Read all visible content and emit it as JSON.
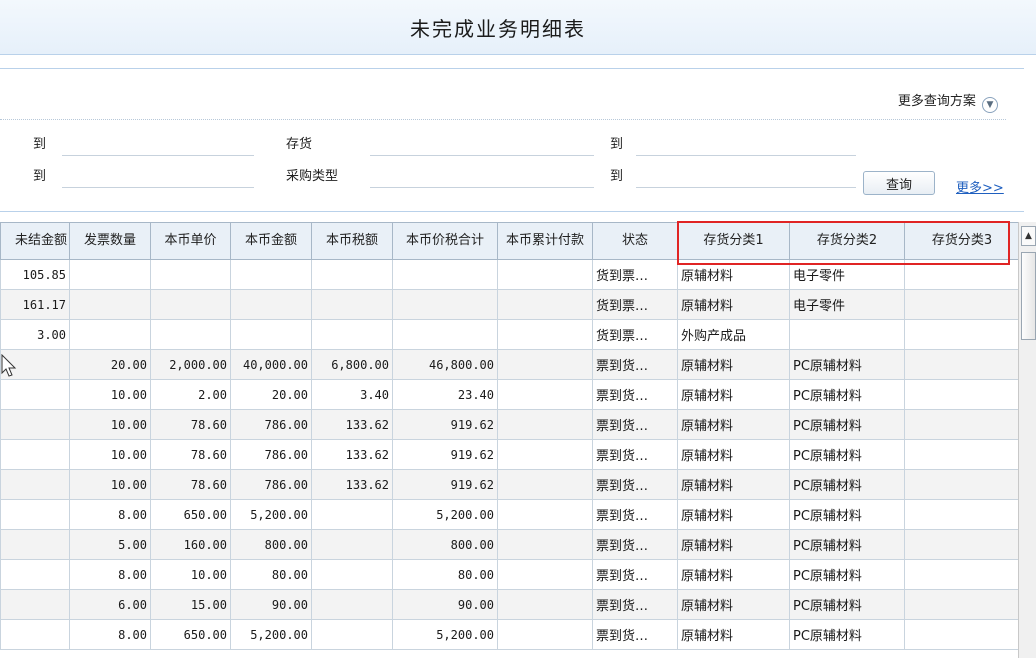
{
  "title": "未完成业务明细表",
  "query": {
    "more_schemes": "更多查询方案",
    "row1": {
      "to_label_1": "到",
      "field_label": "存货",
      "to_label_2": "到"
    },
    "row2": {
      "to_label_1": "到",
      "field_label": "采购类型",
      "to_label_2": "到"
    },
    "query_button": "查询",
    "more_link": "更多>>"
  },
  "table": {
    "headers": [
      "未结金额",
      "发票数量",
      "本币单价",
      "本币金额",
      "本币税额",
      "本币价税合计",
      "本币累计付款",
      "状态",
      "存货分类1",
      "存货分类2",
      "存货分类3"
    ],
    "rows": [
      {
        "c0": "105.85",
        "c1": "",
        "c2": "",
        "c3": "",
        "c4": "",
        "c5": "",
        "c6": "",
        "c7": "货到票…",
        "c8": "原辅材料",
        "c9": "电子零件",
        "c10": ""
      },
      {
        "c0": "161.17",
        "c1": "",
        "c2": "",
        "c3": "",
        "c4": "",
        "c5": "",
        "c6": "",
        "c7": "货到票…",
        "c8": "原辅材料",
        "c9": "电子零件",
        "c10": ""
      },
      {
        "c0": "3.00",
        "c1": "",
        "c2": "",
        "c3": "",
        "c4": "",
        "c5": "",
        "c6": "",
        "c7": "货到票…",
        "c8": "外购产成品",
        "c9": "",
        "c10": ""
      },
      {
        "c0": "",
        "c1": "20.00",
        "c2": "2,000.00",
        "c3": "40,000.00",
        "c4": "6,800.00",
        "c5": "46,800.00",
        "c6": "",
        "c7": "票到货…",
        "c8": "原辅材料",
        "c9": "PC原辅材料",
        "c10": ""
      },
      {
        "c0": "",
        "c1": "10.00",
        "c2": "2.00",
        "c3": "20.00",
        "c4": "3.40",
        "c5": "23.40",
        "c6": "",
        "c7": "票到货…",
        "c8": "原辅材料",
        "c9": "PC原辅材料",
        "c10": ""
      },
      {
        "c0": "",
        "c1": "10.00",
        "c2": "78.60",
        "c3": "786.00",
        "c4": "133.62",
        "c5": "919.62",
        "c6": "",
        "c7": "票到货…",
        "c8": "原辅材料",
        "c9": "PC原辅材料",
        "c10": ""
      },
      {
        "c0": "",
        "c1": "10.00",
        "c2": "78.60",
        "c3": "786.00",
        "c4": "133.62",
        "c5": "919.62",
        "c6": "",
        "c7": "票到货…",
        "c8": "原辅材料",
        "c9": "PC原辅材料",
        "c10": ""
      },
      {
        "c0": "",
        "c1": "10.00",
        "c2": "78.60",
        "c3": "786.00",
        "c4": "133.62",
        "c5": "919.62",
        "c6": "",
        "c7": "票到货…",
        "c8": "原辅材料",
        "c9": "PC原辅材料",
        "c10": ""
      },
      {
        "c0": "",
        "c1": "8.00",
        "c2": "650.00",
        "c3": "5,200.00",
        "c4": "",
        "c5": "5,200.00",
        "c6": "",
        "c7": "票到货…",
        "c8": "原辅材料",
        "c9": "PC原辅材料",
        "c10": ""
      },
      {
        "c0": "",
        "c1": "5.00",
        "c2": "160.00",
        "c3": "800.00",
        "c4": "",
        "c5": "800.00",
        "c6": "",
        "c7": "票到货…",
        "c8": "原辅材料",
        "c9": "PC原辅材料",
        "c10": ""
      },
      {
        "c0": "",
        "c1": "8.00",
        "c2": "10.00",
        "c3": "80.00",
        "c4": "",
        "c5": "80.00",
        "c6": "",
        "c7": "票到货…",
        "c8": "原辅材料",
        "c9": "PC原辅材料",
        "c10": ""
      },
      {
        "c0": "",
        "c1": "6.00",
        "c2": "15.00",
        "c3": "90.00",
        "c4": "",
        "c5": "90.00",
        "c6": "",
        "c7": "票到货…",
        "c8": "原辅材料",
        "c9": "PC原辅材料",
        "c10": ""
      },
      {
        "c0": "",
        "c1": "8.00",
        "c2": "650.00",
        "c3": "5,200.00",
        "c4": "",
        "c5": "5,200.00",
        "c6": "",
        "c7": "票到货…",
        "c8": "原辅材料",
        "c9": "PC原辅材料",
        "c10": ""
      }
    ]
  },
  "icons": {
    "dropdown": "chevron-down-icon",
    "cursor": "mouse-pointer-icon"
  },
  "colors": {
    "highlight": "#e02424",
    "link": "#1f5fbf",
    "header_bg": "#e9f0f7"
  }
}
